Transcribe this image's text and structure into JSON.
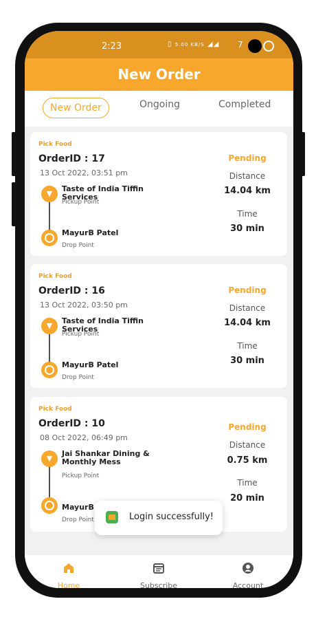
{
  "status_bar": {
    "time": "2:23",
    "net_speed": "5.00 KB/S",
    "battery": "7"
  },
  "app_bar": {
    "title": "New Order"
  },
  "tabs": [
    {
      "label": "New Order"
    },
    {
      "label": "Ongoing"
    },
    {
      "label": "Completed"
    }
  ],
  "orders": [
    {
      "tag": "Pick Food",
      "order_id": "OrderID : 17",
      "datetime": "13 Oct 2022, 03:51 pm",
      "pickup_name": "Taste of India Tiffin Services",
      "pickup_label": "Pickup Point",
      "drop_name": "MayurB Patel",
      "drop_label": "Drop Point",
      "status": "Pending",
      "distance_label": "Distance",
      "distance": "14.04 km",
      "time_label": "Time",
      "time": "30 min"
    },
    {
      "tag": "Pick Food",
      "order_id": "OrderID : 16",
      "datetime": "13 Oct 2022, 03:50 pm",
      "pickup_name": "Taste of India Tiffin Services",
      "pickup_label": "Pickup Point",
      "drop_name": "MayurB Patel",
      "drop_label": "Drop Point",
      "status": "Pending",
      "distance_label": "Distance",
      "distance": "14.04 km",
      "time_label": "Time",
      "time": "30 min"
    },
    {
      "tag": "Pick Food",
      "order_id": "OrderID : 10",
      "datetime": "08 Oct 2022, 06:49 pm",
      "pickup_name": "Jai Shankar Dining & Monthly Mess",
      "pickup_label": "Pickup Point",
      "drop_name": "MayurB Patel",
      "drop_label": "Drop Point",
      "status": "Pending",
      "distance_label": "Distance",
      "distance": "0.75 km",
      "time_label": "Time",
      "time": "20 min"
    }
  ],
  "toast": {
    "message": "Login successfully!"
  },
  "bottom_nav": [
    {
      "label": "Home",
      "icon": "home-icon"
    },
    {
      "label": "Subscribe",
      "icon": "calendar-icon"
    },
    {
      "label": "Account",
      "icon": "account-icon"
    }
  ],
  "colors": {
    "accent": "#f7a72b",
    "status_bar": "#d9901f",
    "background": "#f1f1f1"
  }
}
